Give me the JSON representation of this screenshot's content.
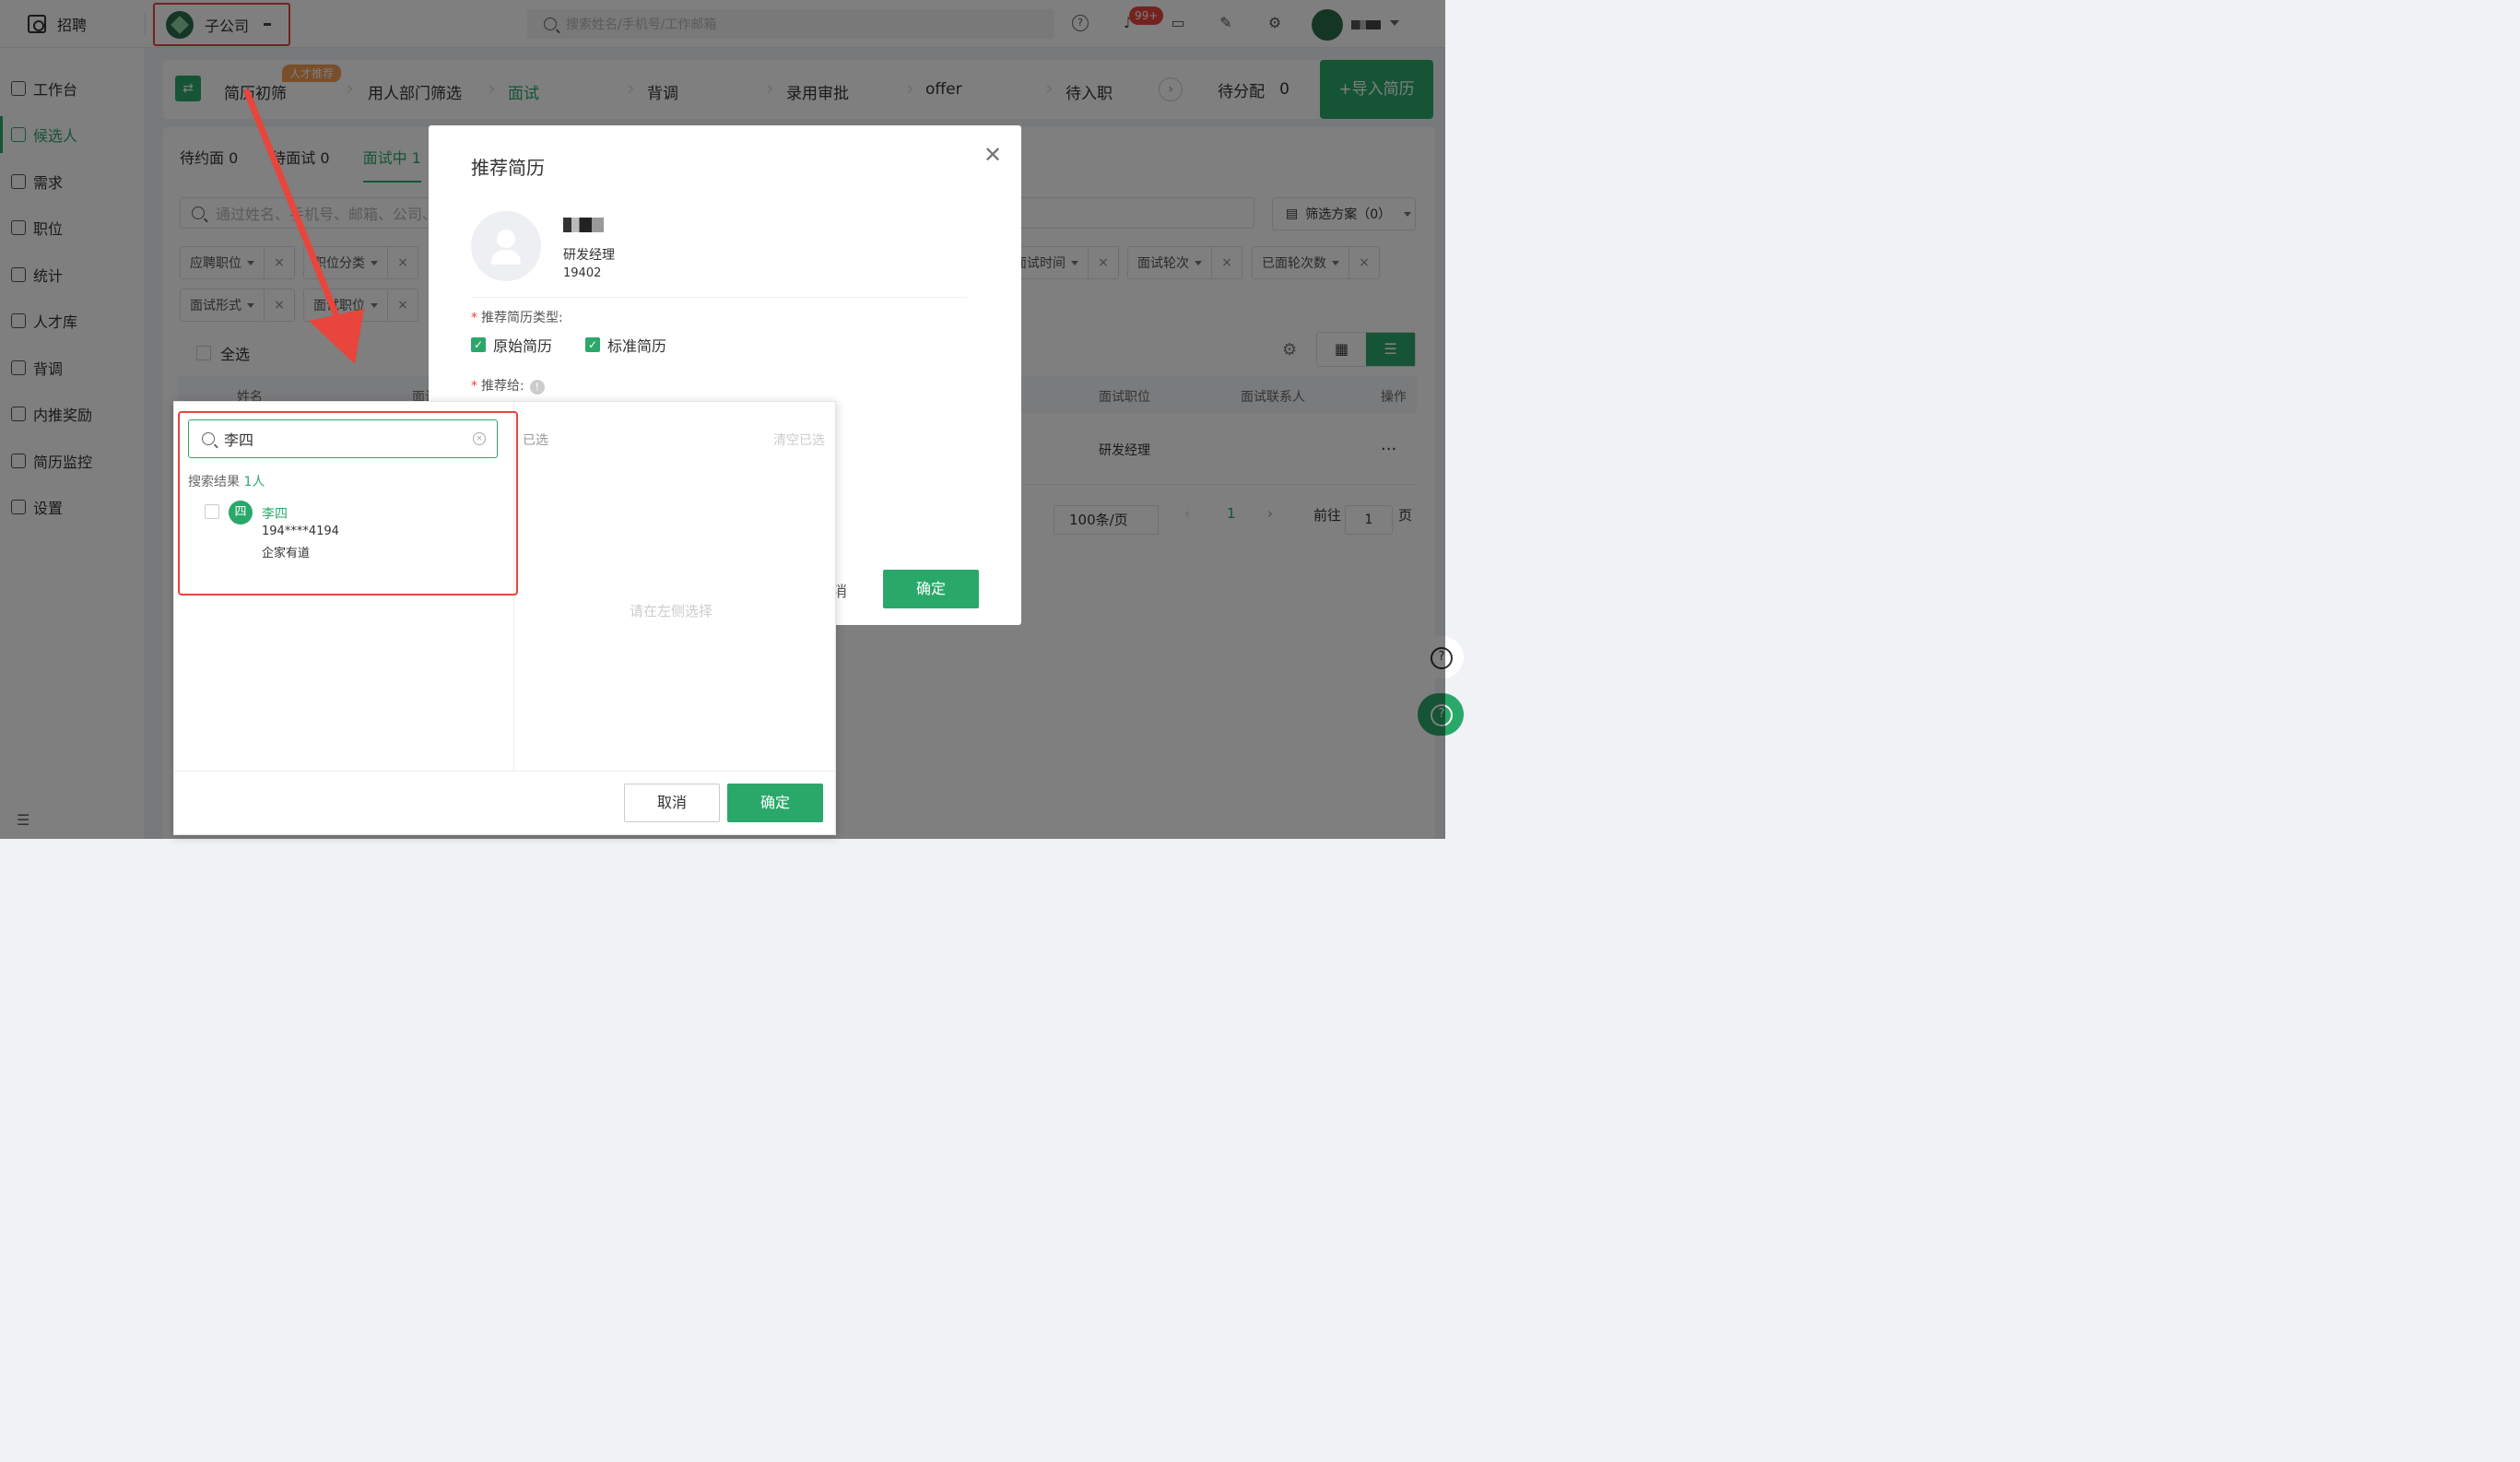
{
  "topbar": {
    "brand": "招聘",
    "company": "子公司",
    "search_placeholder": "搜索姓名/手机号/工作邮箱",
    "notifications_badge": "99+"
  },
  "sidebar": {
    "items": [
      {
        "label": "工作台",
        "icon": "dashboard-icon"
      },
      {
        "label": "候选人",
        "icon": "candidate-icon",
        "active": true
      },
      {
        "label": "需求",
        "icon": "requirement-icon"
      },
      {
        "label": "职位",
        "icon": "briefcase-icon"
      },
      {
        "label": "统计",
        "icon": "chart-icon"
      },
      {
        "label": "人才库",
        "icon": "folder-icon"
      },
      {
        "label": "背调",
        "icon": "person-check-icon"
      },
      {
        "label": "内推奖励",
        "icon": "award-icon"
      },
      {
        "label": "简历监控",
        "icon": "monitor-icon"
      },
      {
        "label": "设置",
        "icon": "gear-icon"
      }
    ]
  },
  "pipeline": {
    "recommend_tag": "人才推荐",
    "stages": [
      "简历初筛",
      "用人部门筛选",
      "面试",
      "背调",
      "录用审批",
      "offer",
      "待入职"
    ],
    "active_stage": "面试",
    "pending_label": "待分配",
    "pending_count": "0",
    "import_label": "+导入简历"
  },
  "subtabs": [
    "待约面 0",
    "待面试 0",
    "面试中 1"
  ],
  "filter": {
    "placeholder": "通过姓名、手机号、邮箱、公司、",
    "scheme_label": "筛选方案（0）",
    "chips_row1_left": [
      "应聘职位",
      "职位分类"
    ],
    "chips_row1_right": [
      "面试时间",
      "面试轮次",
      "已面轮次数"
    ],
    "chips_row2": [
      "面试形式",
      "面试职位"
    ]
  },
  "select_all": "全选",
  "table": {
    "headers": [
      "姓名",
      "面试",
      "面试职位",
      "面试联系人",
      "操作"
    ],
    "row": {
      "position": "研发经理",
      "more": "..."
    }
  },
  "pagination": {
    "page_size": "100条/页",
    "current": "1",
    "goto_label": "前往",
    "goto_value": "1",
    "page_unit": "页"
  },
  "modal": {
    "title": "推荐简历",
    "candidate_position": "研发经理",
    "candidate_contact": "19402",
    "type_label": "推荐简历类型:",
    "types": [
      "原始简历",
      "标准简历"
    ],
    "recommend_to_label": "推荐给:",
    "cancel_peek": "消",
    "ok": "确定"
  },
  "picker": {
    "query": "李四",
    "result_count_label": "搜索结果",
    "result_count": "1人",
    "result": {
      "avatar_char": "四",
      "name": "李四",
      "phone": "194****4194",
      "org": "企家有道"
    },
    "selected_label": "已选",
    "clear_label": "清空已选",
    "empty_hint": "请在左侧选择",
    "cancel": "取消",
    "ok": "确定"
  },
  "colors": {
    "accent": "#2aa86a",
    "highlight": "#e8453c"
  }
}
